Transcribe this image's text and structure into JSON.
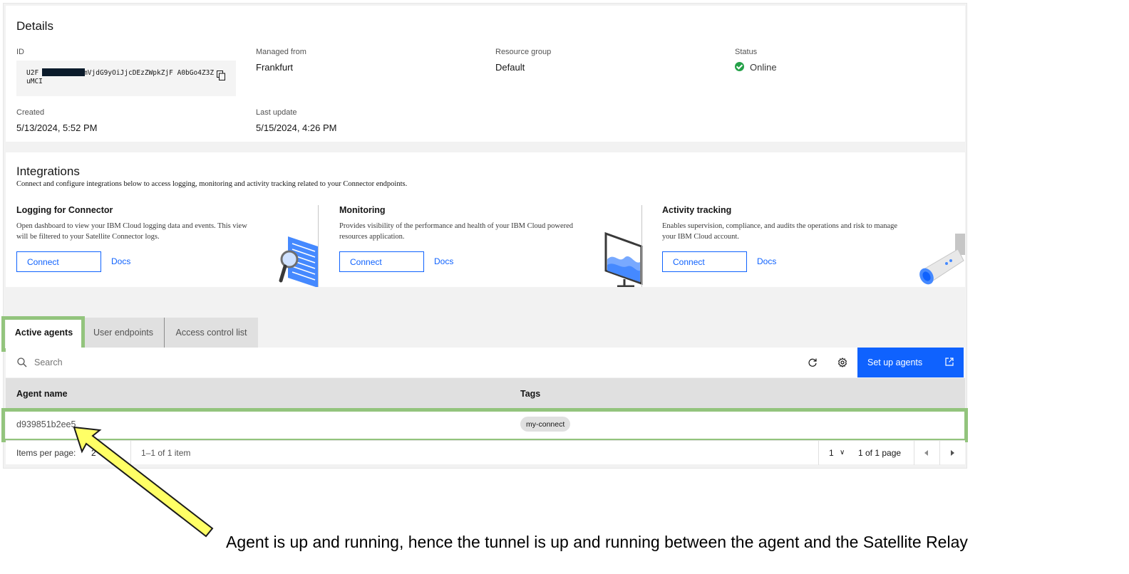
{
  "details": {
    "title": "Details",
    "id_label": "ID",
    "id_value": "U2F      Q29ubmVjdG9yOiJjcDEzZWpkZjF A0bGo4Z3ZuMCI",
    "managed_from_label": "Managed from",
    "managed_from_value": "Frankfurt",
    "resource_group_label": "Resource group",
    "resource_group_value": "Default",
    "status_label": "Status",
    "status_value": "Online",
    "created_label": "Created",
    "created_value": "5/13/2024, 5:52 PM",
    "last_update_label": "Last update",
    "last_update_value": "5/15/2024, 4:26 PM"
  },
  "integrations": {
    "title": "Integrations",
    "subtitle": "Connect and configure integrations below to access logging, monitoring and activity tracking related to your Connector endpoints.",
    "cards": [
      {
        "title": "Logging for Connector",
        "description": "Open dashboard to view your IBM Cloud logging data and events. This view will be filtered to your Satellite Connector logs.",
        "connect_label": "Connect",
        "docs_label": "Docs"
      },
      {
        "title": "Monitoring",
        "description": "Provides visibility of the performance and health of your IBM Cloud powered resources application.",
        "connect_label": "Connect",
        "docs_label": "Docs"
      },
      {
        "title": "Activity tracking",
        "description": "Enables supervision, compliance, and audits the operations and risk to manage your IBM Cloud account.",
        "connect_label": "Connect",
        "docs_label": "Docs"
      }
    ]
  },
  "tabs": [
    {
      "label": "Active agents",
      "active": true
    },
    {
      "label": "User endpoints",
      "active": false
    },
    {
      "label": "Access control list",
      "active": false
    }
  ],
  "toolbar": {
    "search_placeholder": "Search",
    "setup_label": "Set up agents"
  },
  "table": {
    "columns": [
      "Agent name",
      "Tags"
    ],
    "rows": [
      {
        "agent_name": "d939851b2ee5",
        "tag": "my-connect"
      }
    ]
  },
  "pagination": {
    "items_per_page_label": "Items per page:",
    "items_per_page_value": "2",
    "range_text": "1–1 of 1 item",
    "page_value": "1",
    "page_of_text": "1 of 1 page"
  },
  "annotation": {
    "caption": "Agent is up and running, hence the tunnel is up and running between the agent and the Satellite Relay",
    "highlight_color": "#93c47d",
    "arrow_color": "#ffff66"
  },
  "colors": {
    "accent": "#0f62fe",
    "status_online": "#24a148"
  }
}
